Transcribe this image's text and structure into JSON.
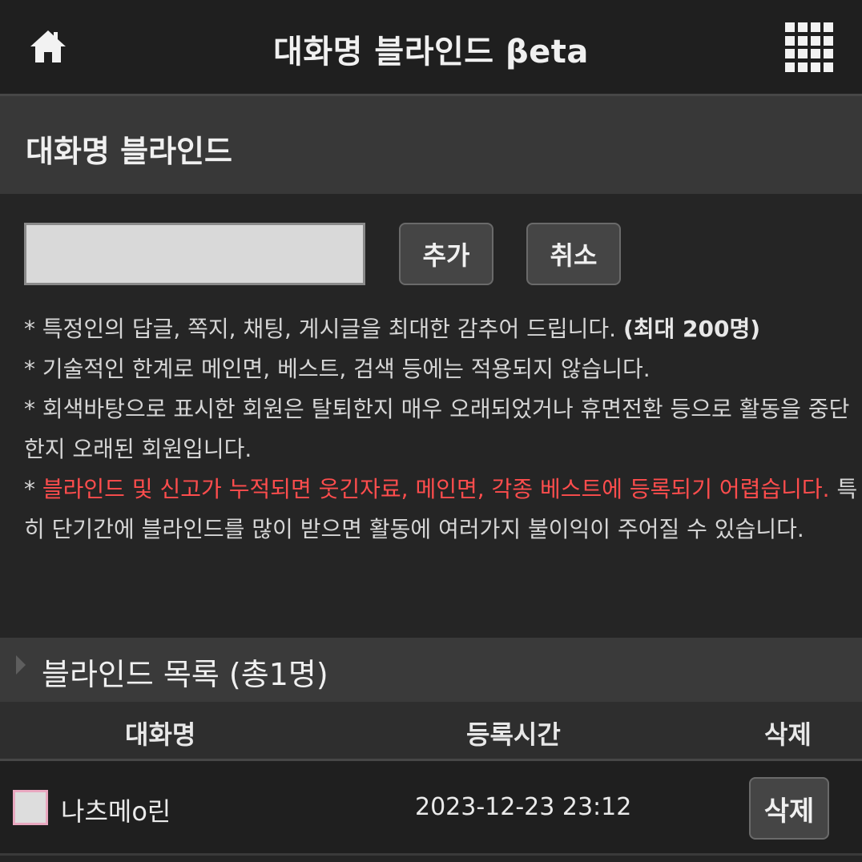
{
  "header": {
    "title": "대화명 블라인드 βeta",
    "home_icon": "home-icon",
    "menu_icon": "grid-menu-icon"
  },
  "section": {
    "title": "대화명 블라인드"
  },
  "form": {
    "input_value": "",
    "add_label": "추가",
    "cancel_label": "취소"
  },
  "notes": {
    "line1": "* 특정인의 답글, 쪽지, 채팅, 게시글을 최대한 감추어 드립니다. ",
    "line1_bold": "(최대 200명)",
    "line2": "* 기술적인 한계로 메인면, 베스트, 검색 등에는 적용되지 않습니다.",
    "line3": "* 회색바탕으로 표시한 회원은 탈퇴한지 매우 오래되었거나 휴면전환 등으로 활동을 중단한지 오래된 회원입니다.",
    "line4_prefix": "* ",
    "line4_red": "블라인드 및 신고가 누적되면 웃긴자료, 메인면, 각종 베스트에 등록되기 어렵습니다.",
    "line4_rest": " 특히 단기간에 블라인드를 많이 받으면 활동에 여러가지 불이익이 주어질 수 있습니다."
  },
  "list": {
    "title": "블라인드 목록 (총1명)",
    "columns": [
      "대화명",
      "등록시간",
      "삭제"
    ],
    "rows": [
      {
        "name": "나츠메o린",
        "time": "2023-12-23 23:12",
        "delete_label": "삭제"
      }
    ]
  },
  "colors": {
    "warning": "#ff4d4d",
    "background": "#252525"
  }
}
